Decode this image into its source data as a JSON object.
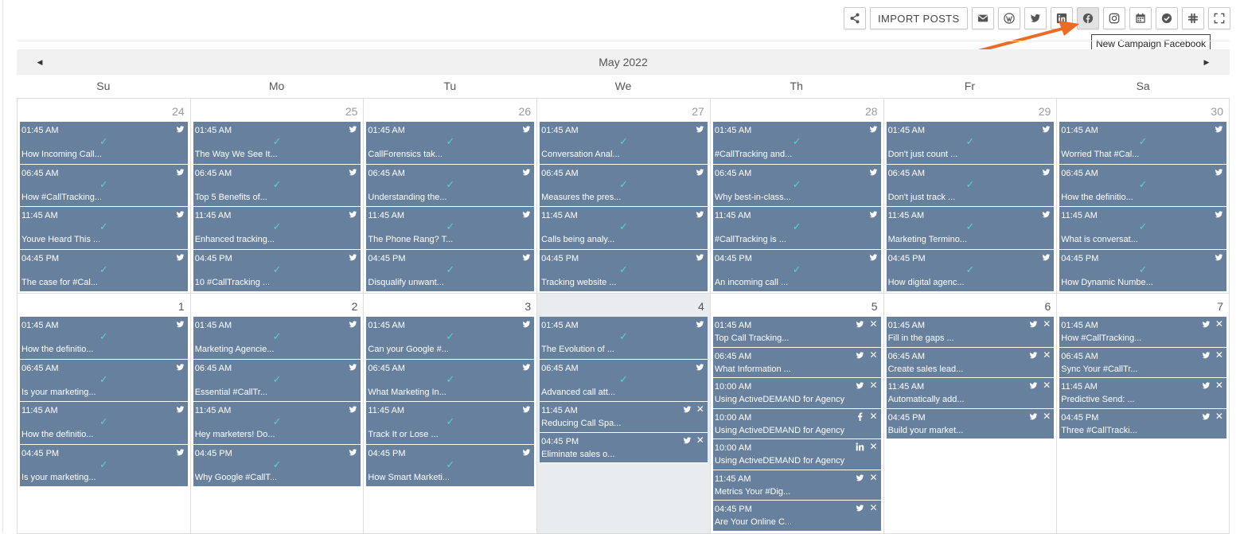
{
  "toolbar": {
    "import_label": "IMPORT POSTS",
    "tooltip": "New Campaign Facebook"
  },
  "calendar": {
    "month_label": "May 2022",
    "prev_icon": "triangle-left-icon",
    "next_icon": "triangle-right-icon",
    "days_of_week": [
      "Su",
      "Mo",
      "Tu",
      "We",
      "Th",
      "Fr",
      "Sa"
    ],
    "colors": {
      "event_bg": "#66809d",
      "check": "#5ad2c9",
      "today_bg": "#e8ecef",
      "arrow": "#ef6a22"
    },
    "week1": {
      "days": [
        {
          "num": "24",
          "events": [
            {
              "time": "01:45 AM",
              "title": "How Incoming Call..."
            },
            {
              "time": "06:45 AM",
              "title": "How #CallTracking..."
            },
            {
              "time": "11:45 AM",
              "title": "Youve Heard This ..."
            },
            {
              "time": "04:45 PM",
              "title": "The case for #Cal..."
            }
          ]
        },
        {
          "num": "25",
          "events": [
            {
              "time": "01:45 AM",
              "title": "The Way We See It..."
            },
            {
              "time": "06:45 AM",
              "title": "Top 5 Benefits of..."
            },
            {
              "time": "11:45 AM",
              "title": "Enhanced tracking..."
            },
            {
              "time": "04:45 PM",
              "title": "10 #CallTracking ..."
            }
          ]
        },
        {
          "num": "26",
          "events": [
            {
              "time": "01:45 AM",
              "title": "CallForensics tak..."
            },
            {
              "time": "06:45 AM",
              "title": "Understanding the..."
            },
            {
              "time": "11:45 AM",
              "title": "The Phone Rang? T..."
            },
            {
              "time": "04:45 PM",
              "title": "Disqualify unwant..."
            }
          ]
        },
        {
          "num": "27",
          "events": [
            {
              "time": "01:45 AM",
              "title": "Conversation Anal..."
            },
            {
              "time": "06:45 AM",
              "title": "Measures the pres..."
            },
            {
              "time": "11:45 AM",
              "title": "Calls being analy..."
            },
            {
              "time": "04:45 PM",
              "title": "Tracking website ..."
            }
          ]
        },
        {
          "num": "28",
          "events": [
            {
              "time": "01:45 AM",
              "title": "#CallTracking and..."
            },
            {
              "time": "06:45 AM",
              "title": "Why best-in-class..."
            },
            {
              "time": "11:45 AM",
              "title": "#CallTracking is ..."
            },
            {
              "time": "04:45 PM",
              "title": "An incoming call ..."
            }
          ]
        },
        {
          "num": "29",
          "events": [
            {
              "time": "01:45 AM",
              "title": "Don't just count ..."
            },
            {
              "time": "06:45 AM",
              "title": "Don't just track ..."
            },
            {
              "time": "11:45 AM",
              "title": "Marketing Termino..."
            },
            {
              "time": "04:45 PM",
              "title": "How digital agenc..."
            }
          ]
        },
        {
          "num": "30",
          "events": [
            {
              "time": "01:45 AM",
              "title": "Worried That #Cal..."
            },
            {
              "time": "06:45 AM",
              "title": "How the definitio..."
            },
            {
              "time": "11:45 AM",
              "title": "What is conversat..."
            },
            {
              "time": "04:45 PM",
              "title": "How Dynamic Numbe..."
            }
          ]
        }
      ]
    },
    "week2": {
      "days": [
        {
          "num": "1",
          "events": [
            {
              "time": "01:45 AM",
              "title": "How the definitio..."
            },
            {
              "time": "06:45 AM",
              "title": "Is your marketing..."
            },
            {
              "time": "11:45 AM",
              "title": "How the definitio..."
            },
            {
              "time": "04:45 PM",
              "title": "Is your marketing..."
            }
          ]
        },
        {
          "num": "2",
          "events": [
            {
              "time": "01:45 AM",
              "title": "Marketing Agencie..."
            },
            {
              "time": "06:45 AM",
              "title": "Essential #CallTr..."
            },
            {
              "time": "11:45 AM",
              "title": "Hey marketers! Do..."
            },
            {
              "time": "04:45 PM",
              "title": "Why Google #CallT..."
            }
          ]
        },
        {
          "num": "3",
          "events": [
            {
              "time": "01:45 AM",
              "title": "Can your Google #..."
            },
            {
              "time": "06:45 AM",
              "title": "What Marketing In..."
            },
            {
              "time": "11:45 AM",
              "title": "Track It or Lose ..."
            },
            {
              "time": "04:45 PM",
              "title": "How Smart Marketi..."
            }
          ]
        },
        {
          "num": "4",
          "events": [
            {
              "time": "01:45 AM",
              "title": "The Evolution of ..."
            },
            {
              "time": "06:45 AM",
              "title": "Advanced call att..."
            },
            {
              "time": "11:45 AM",
              "title": "Reducing Call Spa..."
            },
            {
              "time": "04:45 PM",
              "title": "Eliminate sales o..."
            }
          ]
        },
        {
          "num": "5",
          "events": [
            {
              "time": "01:45 AM",
              "title": "Top Call Tracking..."
            },
            {
              "time": "06:45 AM",
              "title": "What Information ..."
            },
            {
              "time": "10:00 AM",
              "title": "Using ActiveDEMAND for Agency"
            },
            {
              "time": "10:00 AM",
              "title": "Using ActiveDEMAND for Agency"
            },
            {
              "time": "10:00 AM",
              "title": "Using ActiveDEMAND for Agency"
            },
            {
              "time": "11:45 AM",
              "title": "Metrics Your #Dig..."
            },
            {
              "time": "04:45 PM",
              "title": "Are Your Online C..."
            }
          ]
        },
        {
          "num": "6",
          "events": [
            {
              "time": "01:45 AM",
              "title": "Fill in the gaps ..."
            },
            {
              "time": "06:45 AM",
              "title": "Create sales lead..."
            },
            {
              "time": "11:45 AM",
              "title": "Automatically add..."
            },
            {
              "time": "04:45 PM",
              "title": "Build your market..."
            }
          ]
        },
        {
          "num": "7",
          "events": [
            {
              "time": "01:45 AM",
              "title": "How #CallTracking..."
            },
            {
              "time": "06:45 AM",
              "title": "Sync Your #CallTr..."
            },
            {
              "time": "11:45 AM",
              "title": "Predictive Send: ..."
            },
            {
              "time": "04:45 PM",
              "title": "Three #CallTracki..."
            }
          ]
        }
      ]
    }
  }
}
